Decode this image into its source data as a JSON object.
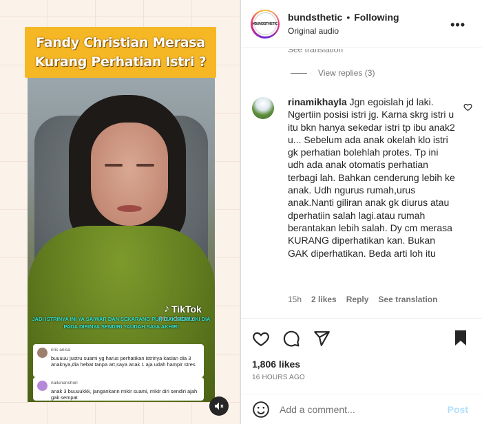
{
  "post": {
    "video_title_line1": "Fandy Christian Merasa",
    "video_title_line2": "Kurang Perhatian Istri ?",
    "tiktok_label": "TikTok",
    "tiktok_handle": "@bundsthetic",
    "caption": "JADI ISTRINYA INI YA SAIWAR DAN SEKARANG PUN GAK MEMILIKI DIA PADA DIRINYA SENDIRI YAUDAH SAYA AKHIRI",
    "overlay_comments": [
      {
        "name": "riris anisa",
        "text": "buuuuu justru suami yg harus perhatikan istrinya kasian dia 3 anaknya,dia hebat tanpa art,saya anak 1 aja udah hampir stres"
      },
      {
        "name": "nailunanshori",
        "text": "anak 3 buuuukkk, jangankann mikir suami, mikir diri sendiri ajah gak sempat"
      }
    ],
    "mute_icon": "speaker-muted-icon"
  },
  "header": {
    "username": "bundsthetic",
    "separator": "•",
    "follow_status": "Following",
    "audio": "Original audio",
    "avatar_text": "#BUNDSTHETIC",
    "more_icon": "more-horizontal-icon"
  },
  "comments": {
    "clipped_see_translation": "See translation",
    "view_replies": "View replies (3)",
    "items": [
      {
        "username": "rinamikhayla",
        "text": "Jgn egoislah jd laki. Ngertiin posisi istri jg. Karna skrg istri u itu bkn hanya sekedar istri tp ibu anak2 u... Sebelum ada anak okelah klo istri gk perhatian bolehlah protes. Tp ini udh ada anak otomatis perhatian terbagi lah. Bahkan cenderung lebih ke anak. Udh ngurus rumah,urus anak.Nanti giliran anak gk diurus atau dperhatiin salah lagi.atau rumah berantakan lebih salah. Dy cm merasa KURANG diperhatikan kan. Bukan GAK diperhatikan. Beda arti loh itu",
        "time": "15h",
        "likes": "2 likes",
        "reply": "Reply",
        "translation": "See translation"
      }
    ]
  },
  "actions": {
    "likes": "1,806 likes",
    "posted": "16 HOURS AGO"
  },
  "add_comment": {
    "placeholder": "Add a comment...",
    "post_label": "Post"
  },
  "colors": {
    "banner": "#f6b724",
    "caption": "#2ee2d2",
    "post_disabled": "#b2dffc",
    "secondary_text": "#737373"
  }
}
